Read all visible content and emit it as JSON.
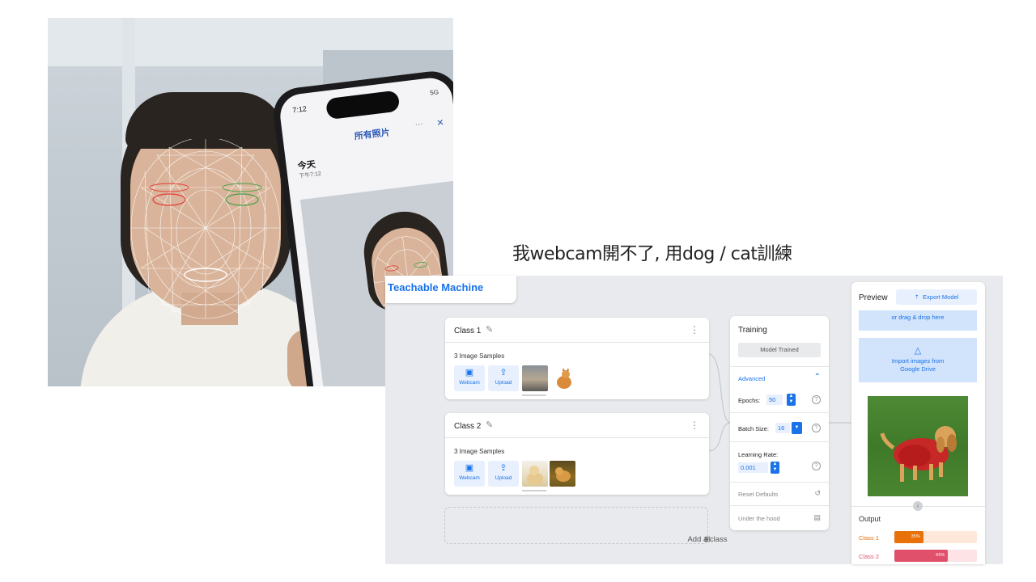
{
  "caption": "我webcam開不了, 用dog / cat訓練",
  "phone": {
    "time": "7:12",
    "status_right": "5G",
    "header_title": "所有照片",
    "dots": "···",
    "close": "✕",
    "today": "今天",
    "today_sub": "下午7:12"
  },
  "app": {
    "logo": "Teachable Machine",
    "classes": [
      {
        "title": "Class 1",
        "samples": "3 Image Samples",
        "webcam_label": "Webcam",
        "upload_label": "Upload"
      },
      {
        "title": "Class 2",
        "samples": "3 Image Samples",
        "webcam_label": "Webcam",
        "upload_label": "Upload"
      }
    ],
    "add_class": "Add a class",
    "training": {
      "title": "Training",
      "button": "Model Trained",
      "advanced": "Advanced",
      "epochs_label": "Epochs:",
      "epochs_value": "50",
      "batch_label": "Batch Size:",
      "batch_value": "16",
      "lr_label": "Learning Rate:",
      "lr_value": "0.001",
      "reset": "Reset Defaults",
      "hood": "Under the hood"
    },
    "preview": {
      "title": "Preview",
      "export": "Export Model",
      "drop_text": "or drag & drop here",
      "drive_line1": "Import images from",
      "drive_line2": "Google Drive",
      "output_title": "Output",
      "outputs": [
        {
          "label": "Class 1",
          "percent": 35,
          "percent_text": "35%",
          "color": "#e8710a",
          "track": "#fde8da"
        },
        {
          "label": "Class 2",
          "percent": 65,
          "percent_text": "65%",
          "color": "#e0506b",
          "track": "#fde2e6"
        }
      ]
    }
  }
}
